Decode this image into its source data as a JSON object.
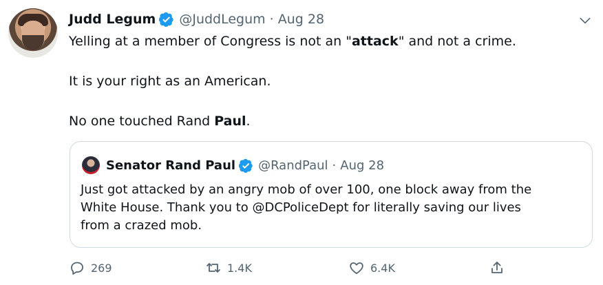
{
  "author": {
    "name": "Judd Legum",
    "handle": "@JuddLegum",
    "separator": "·",
    "date": "Aug 28"
  },
  "tweet": {
    "line1_before": "Yelling at a member of Congress is not an \"",
    "line1_bold": "attack",
    "line1_after": "\" and not a crime.",
    "line2": "It is your right as an American.",
    "line3_before": "No one touched Rand ",
    "line3_bold": "Paul",
    "line3_after": "."
  },
  "quote": {
    "name": "Senator Rand Paul",
    "handle": "@RandPaul",
    "separator": "·",
    "date": "Aug 28",
    "text_line1": "Just got attacked by an angry mob of over 100, one block away from the",
    "text_line2": "White House. Thank you to @DCPoliceDept for literally saving our lives",
    "text_line3": "from a crazed mob."
  },
  "actions": {
    "reply_count": "269",
    "retweet_count": "1.4K",
    "like_count": "6.4K"
  },
  "colors": {
    "verified": "#1d9bf0",
    "secondary_text": "#536471",
    "border": "#cfd9de"
  },
  "icons": {
    "verified": "verified-badge-icon",
    "chevron": "chevron-down-icon",
    "reply": "reply-icon",
    "retweet": "retweet-icon",
    "like": "heart-icon",
    "share": "share-icon"
  }
}
